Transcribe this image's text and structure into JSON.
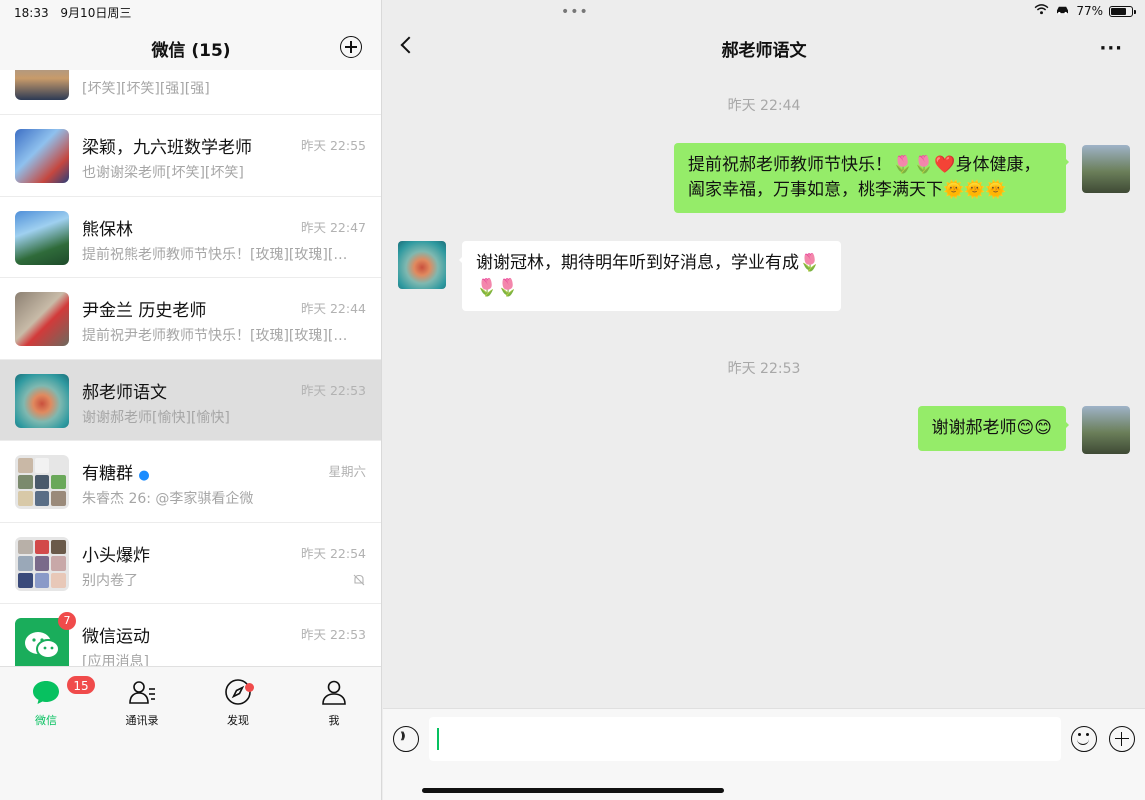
{
  "status": {
    "time": "18:33",
    "date": "9月10日周三",
    "battery": "77%",
    "battery_level": 0.77
  },
  "left_header": {
    "title": "微信 (15)"
  },
  "chats": [
    {
      "name": "",
      "time": "",
      "preview": "[坏笑][坏笑][强][强]"
    },
    {
      "name": "梁颖，九六班数学老师",
      "time": "昨天 22:55",
      "preview": "也谢谢梁老师[坏笑][坏笑]"
    },
    {
      "name": "熊保林",
      "time": "昨天 22:47",
      "preview": "提前祝熊老师教师节快乐！[玫瑰][玫瑰][玫瑰]"
    },
    {
      "name": "尹金兰 历史老师",
      "time": "昨天 22:44",
      "preview": "提前祝尹老师教师节快乐！[玫瑰][玫瑰][玫瑰]"
    },
    {
      "name": "郝老师语文",
      "time": "昨天 22:53",
      "preview": "谢谢郝老师[愉快][愉快]"
    },
    {
      "name": "有糖群",
      "time": "星期六",
      "preview": "朱睿杰 26: @李家骐看企微"
    },
    {
      "name": "小头爆炸",
      "time": "昨天 22:54",
      "preview": "别内卷了"
    },
    {
      "name": "微信运动",
      "time": "昨天 22:53",
      "preview": "[应用消息]",
      "badge": "7"
    }
  ],
  "tabs": [
    {
      "label": "微信",
      "badge": "15"
    },
    {
      "label": "通讯录"
    },
    {
      "label": "发现"
    },
    {
      "label": "我"
    }
  ],
  "conversation": {
    "title": "郝老师语文",
    "time_1": "昨天 22:44",
    "msg_1": "提前祝郝老师教师节快乐！🌷🌷❤️身体健康，阖家幸福，万事如意，桃李满天下🌞🌞🌞",
    "msg_2": "谢谢冠林，期待明年听到好消息，学业有成🌷🌷🌷",
    "time_2": "昨天 22:53",
    "msg_3": "谢谢郝老师😊😊"
  },
  "input": {
    "value": ""
  },
  "colors": {
    "accent": "#07c160",
    "my_bubble": "#95ec69",
    "badge": "#f04b4b"
  }
}
